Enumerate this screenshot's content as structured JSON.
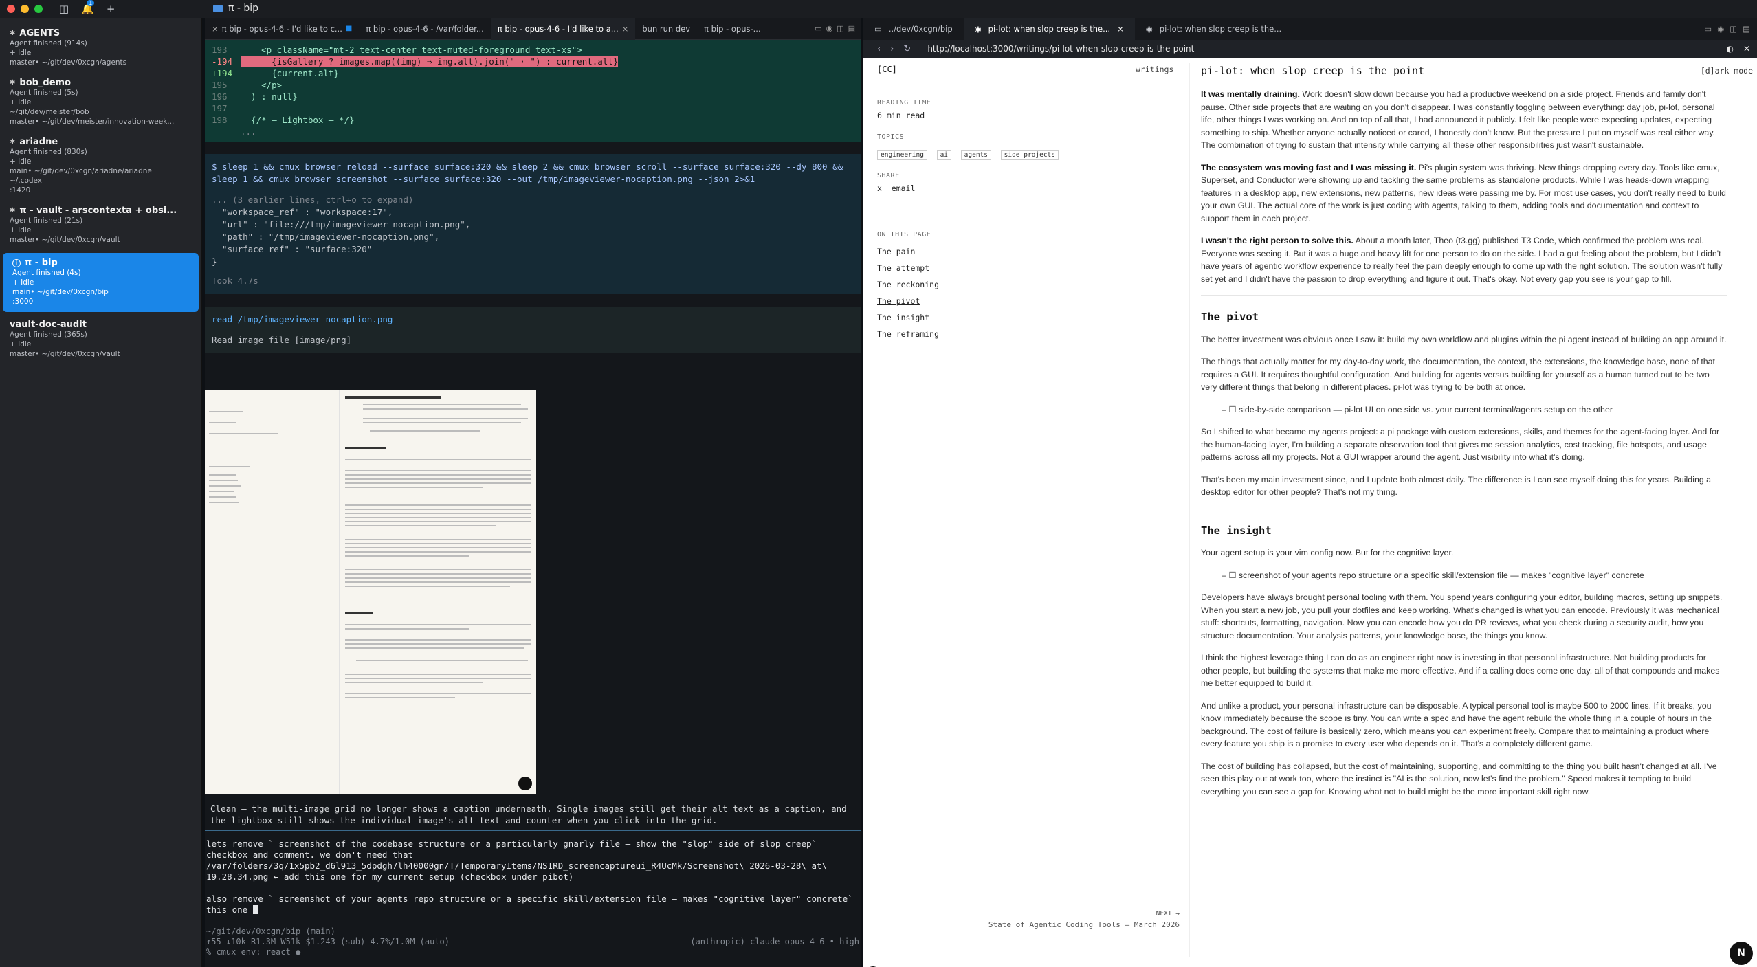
{
  "window": {
    "title": "π - bip",
    "traffic_colors": [
      "#ff5f57",
      "#febc2e",
      "#28c840"
    ],
    "notif_count": "1"
  },
  "sidebar": {
    "workspaces": [
      {
        "title": "AGENTS",
        "lines": [
          "Agent finished (914s)",
          "+ Idle",
          "master• ~/git/dev/0xcgn/agents"
        ]
      },
      {
        "title": "bob_demo",
        "lines": [
          "Agent finished (5s)",
          "+ Idle",
          "~/git/dev/meister/bob",
          "master• ~/git/dev/meister/innovation-week..."
        ]
      },
      {
        "title": "ariadne",
        "lines": [
          "Agent finished (830s)",
          "+ Idle",
          "main• ~/git/dev/0xcgn/ariadne/ariadne",
          "~/.codex",
          ":1420"
        ]
      },
      {
        "title": "π - vault - arscontexta + obsi...",
        "lines": [
          "Agent finished (21s)",
          "+ Idle",
          "master• ~/git/dev/0xcgn/vault"
        ]
      },
      {
        "title": "π - bip",
        "lines": [
          "Agent finished (4s)",
          "+ Idle",
          "main• ~/git/dev/0xcgn/bip",
          ":3000"
        ]
      },
      {
        "title": "vault-doc-audit",
        "lines": [
          "Agent finished (365s)",
          "+ Idle",
          "master• ~/git/dev/0xcgn/vault"
        ]
      }
    ]
  },
  "terminal": {
    "tabs": [
      "π bip - opus-4-6 - I'd like to c...",
      "π bip - opus-4-6 - /var/folder...",
      "π bip - opus-4-6 - I'd like to a...",
      "bun run dev",
      "π bip - opus-..."
    ],
    "code_lines": [
      {
        "n": "193",
        "t": "    <p className=\"mt-2 text-center text-muted-foreground text-xs\">"
      },
      {
        "n": "-194",
        "t": "      {isGallery ? images.map((img) ⇒ img.alt).join(\" · \") : current.alt}"
      },
      {
        "n": "+194",
        "t": "      {current.alt}"
      },
      {
        "n": "195",
        "t": "    </p>"
      },
      {
        "n": "196",
        "t": "  ) : null}"
      },
      {
        "n": "197",
        "t": ""
      },
      {
        "n": "198",
        "t": "  {/* — Lightbox — */}"
      },
      {
        "n": "",
        "t": "..."
      }
    ],
    "command": "$ sleep 1 && cmux browser reload --surface surface:320 && sleep 2 && cmux browser scroll --surface surface:320 --dy 800 && sleep 1 && cmux browser screenshot --surface surface:320 --out /tmp/imageviewer-nocaption.png --json 2>&1",
    "cmd_output": [
      "... (3 earlier lines, ctrl+o to expand)",
      "  \"workspace_ref\" : \"workspace:17\",",
      "  \"url\" : \"file:///tmp/imageviewer-nocaption.png\",",
      "  \"path\" : \"/tmp/imageviewer-nocaption.png\",",
      "  \"surface_ref\" : \"surface:320\"",
      "}"
    ],
    "took": "Took 4.7s",
    "read_cmd": "read /tmp/imageviewer-nocaption.png",
    "read_out": "Read image file [image/png]",
    "clean_msg": "Clean — the multi-image grid no longer shows a caption underneath. Single images still get their alt text as a caption, and the lightbox still shows the individual image's alt text and counter when you click into the grid.",
    "prompt_text": "lets remove ` screenshot of the codebase structure or a particularly gnarly file — show the \"slop\" side of slop creep` checkbox and comment. we don't need that\n/var/folders/3q/1x5pb2_d6l913_5dpdgh7lh40000gn/T/TemporaryItems/NSIRD_screencaptureui_R4UcMk/Screenshot\\ 2026-03-28\\ at\\ 19.28.34.png ← add this one for my current setup (checkbox under pibot)\n\nalso remove ` screenshot of your agents repo structure or a specific skill/extension file — makes \"cognitive layer\" concrete` this one ",
    "status_path": "~/git/dev/0xcgn/bip (main)",
    "status_stats": "↑55 ↓10k R1.3M W51k $1.243 (sub) 4.7%/1.0M (auto)",
    "status_model": "(anthropic) claude-opus-4-6 • high",
    "status_env": "% cmux env: react ●"
  },
  "browser": {
    "tabs": [
      "../dev/0xcgn/bip",
      "pi-lot: when slop creep is the...",
      "pi-lot: when slop creep is the..."
    ],
    "url": "http://localhost:3000/writings/pi-lot-when-slop-creep-is-the-point",
    "page": {
      "logo": "[CC]",
      "nav_writings": "writings",
      "title": "pi-lot: when slop creep is the point",
      "dark_mode": "[d]ark mode",
      "reading_time_label": "READING TIME",
      "reading_time": "6 min read",
      "topics_label": "TOPICS",
      "topics": [
        "engineering",
        "ai",
        "agents",
        "side projects"
      ],
      "share_label": "SHARE",
      "share": "x  email",
      "toc_label": "ON THIS PAGE",
      "toc": [
        "The pain",
        "The attempt",
        "The reckoning",
        "The pivot",
        "The insight",
        "The reframing"
      ],
      "next_label": "NEXT →",
      "next_title": "State of Agentic Coding Tools — March 2026",
      "paragraphs": [
        {
          "lead": "It was mentally draining.",
          "text": " Work doesn't slow down because you had a productive weekend on a side project. Friends and family don't pause. Other side projects that are waiting on you don't disappear. I was constantly toggling between everything: day job, pi-lot, personal life, other things I was working on. And on top of all that, I had announced it publicly. I felt like people were expecting updates, expecting something to ship. Whether anyone actually noticed or cared, I honestly don't know. But the pressure I put on myself was real either way. The combination of trying to sustain that intensity while carrying all these other responsibilities just wasn't sustainable."
        },
        {
          "lead": "The ecosystem was moving fast and I was missing it.",
          "text": " Pi's plugin system was thriving. New things dropping every day. Tools like cmux, Superset, and Conductor were showing up and tackling the same problems as standalone products. While I was heads-down wrapping features in a desktop app, new extensions, new patterns, new ideas were passing me by. For most use cases, you don't really need to build your own GUI. The actual core of the work is just coding with agents, talking to them, adding tools and documentation and context to support them in each project."
        },
        {
          "lead": "I wasn't the right person to solve this.",
          "text": " About a month later, Theo (t3.gg) published T3 Code, which confirmed the problem was real. Everyone was seeing it. But it was a huge and heavy lift for one person to do on the side. I had a gut feeling about the problem, but I didn't have years of agentic workflow experience to really feel the pain deeply enough to come up with the right solution. The solution wasn't fully set yet and I didn't have the passion to drop everything and figure it out. That's okay. Not every gap you see is your gap to fill."
        }
      ],
      "pivot_heading": "The pivot",
      "pivot_paragraphs": [
        "The better investment was obvious once I saw it: build my own workflow and plugins within the pi agent instead of building an app around it.",
        "The things that actually matter for my day-to-day work, the documentation, the context, the extensions, the knowledge base, none of that requires a GUI. It requires thoughtful configuration. And building for agents versus building for yourself as a human turned out to be two very different things that belong in different places. pi-lot was trying to be both at once."
      ],
      "pivot_checkbox": "– ☐ side-by-side comparison — pi-lot UI on one side vs. your current terminal/agents setup on the other",
      "pivot_after": [
        "So I shifted to what became my agents project: a pi package with custom extensions, skills, and themes for the agent-facing layer. And for the human-facing layer, I'm building a separate observation tool that gives me session analytics, cost tracking, file hotspots, and usage patterns across all my projects. Not a GUI wrapper around the agent. Just visibility into what it's doing.",
        "That's been my main investment since, and I update both almost daily. The difference is I can see myself doing this for years. Building a desktop editor for other people? That's not my thing."
      ],
      "insight_heading": "The insight",
      "insight_lead": "Your agent setup is your vim config now. But for the cognitive layer.",
      "insight_checkbox": "– ☐ screenshot of your agents repo structure or a specific skill/extension file — makes \"cognitive layer\" concrete",
      "insight_paragraphs": [
        "Developers have always brought personal tooling with them. You spend years configuring your editor, building macros, setting up snippets. When you start a new job, you pull your dotfiles and keep working. What's changed is what you can encode. Previously it was mechanical stuff: shortcuts, formatting, navigation. Now you can encode how you do PR reviews, what you check during a security audit, how you structure documentation. Your analysis patterns, your knowledge base, the things you know.",
        "I think the highest leverage thing I can do as an engineer right now is investing in that personal infrastructure. Not building products for other people, but building the systems that make me more effective. And if a calling does come one day, all of that compounds and makes me better equipped to build it.",
        "And unlike a product, your personal infrastructure can be disposable. A typical personal tool is maybe 500 to 2000 lines. If it breaks, you know immediately because the scope is tiny. You can write a spec and have the agent rebuild the whole thing in a couple of hours in the background. The cost of failure is basically zero, which means you can experiment freely. Compare that to maintaining a product where every feature you ship is a promise to every user who depends on it. That's a completely different game.",
        "The cost of building has collapsed, but the cost of maintaining, supporting, and committing to the thing you built hasn't changed at all. I've seen this play out at work too, where the instinct is \"AI is the solution, now let's find the problem.\" Speed makes it tempting to build everything you can see a gap for. Knowing what not to build might be the more important skill right now."
      ]
    }
  }
}
